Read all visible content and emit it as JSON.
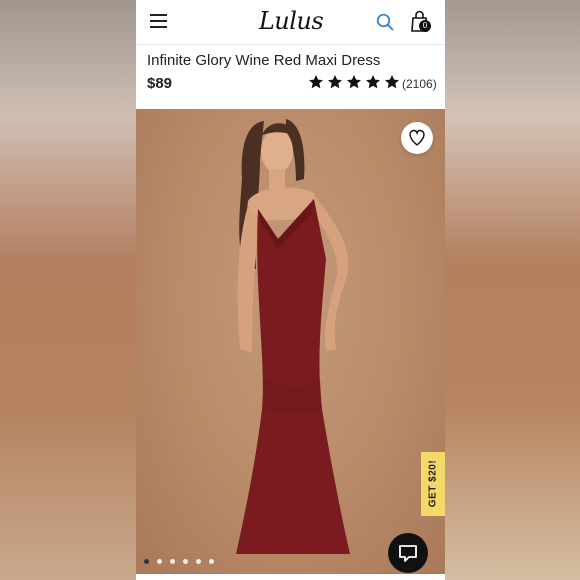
{
  "header": {
    "brand": "Lulus",
    "cart_count": "0",
    "icons": [
      "menu-icon",
      "search-icon",
      "shopping-bag-icon"
    ]
  },
  "product": {
    "title": "Infinite Glory Wine Red Maxi Dress",
    "price": "$89",
    "rating_stars": 5,
    "review_count": "(2106)"
  },
  "gallery": {
    "image_count": 6,
    "active_index": 0,
    "dress_color": "#7a1c1f"
  },
  "promo": {
    "label": "GET $20!"
  },
  "colors": {
    "accent_blue": "#2f7fcf",
    "promo_yellow": "#f4d86a"
  }
}
